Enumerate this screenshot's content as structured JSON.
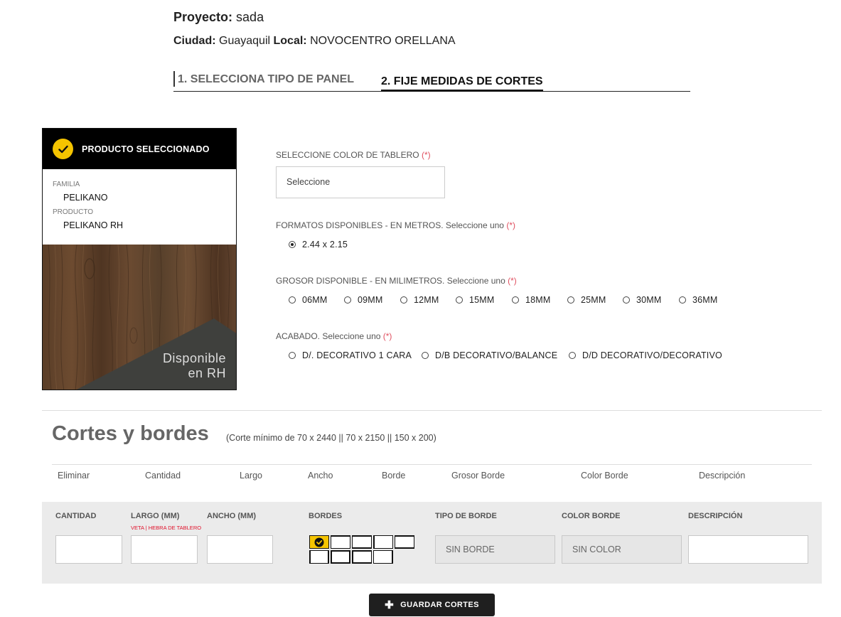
{
  "header": {
    "proyecto_label": "Proyecto:",
    "proyecto_value": "sada",
    "ciudad_label": "Ciudad:",
    "ciudad_value": "Guayaquil",
    "local_label": "Local:",
    "local_value": "NOVOCENTRO ORELLANA"
  },
  "steps": {
    "step1": "1. SELECCIONA TIPO DE PANEL",
    "step2": "2. FIJE MEDIDAS DE CORTES"
  },
  "product_card": {
    "title": "PRODUCTO SELECCIONADO",
    "familia_label": "FAMILIA",
    "familia_value": "PELIKANO",
    "producto_label": "PRODUCTO",
    "producto_value": "PELIKANO RH",
    "badge_line1": "Disponible",
    "badge_line2": "en RH",
    "accent_color": "#f5c400"
  },
  "form": {
    "color_label": "SELECCIONE COLOR DE TABLERO",
    "required_mark": "(*)",
    "color_placeholder": "Seleccione",
    "formatos_label": "FORMATOS DISPONIBLES - EN METROS. Seleccione uno",
    "formatos_options": [
      "2.44 x 2.15"
    ],
    "formatos_selected": "2.44 x 2.15",
    "grosor_label": "GROSOR DISPONIBLE - EN MILIMETROS. Seleccione uno",
    "grosor_options": [
      "06MM",
      "09MM",
      "12MM",
      "15MM",
      "18MM",
      "25MM",
      "30MM",
      "36MM"
    ],
    "acabado_label": "ACABADO. Seleccione uno",
    "acabado_options": [
      "D/. DECORATIVO 1 CARA",
      "D/B DECORATIVO/BALANCE",
      "D/D DECORATIVO/DECORATIVO"
    ]
  },
  "cortes": {
    "title": "Cortes y bordes",
    "note": "(Corte mínimo de 70 x 2440 || 70 x 2150 || 150 x 200)",
    "columns": [
      "Eliminar",
      "Cantidad",
      "Largo",
      "Ancho",
      "Borde",
      "Grosor Borde",
      "Color Borde",
      "Descripción"
    ]
  },
  "entry": {
    "cantidad_label": "CANTIDAD",
    "largo_label": "LARGO (MM)",
    "veta_note": "VETA | HEBRA DE TABLERO",
    "ancho_label": "ANCHO (MM)",
    "bordes_label": "BORDES",
    "tipo_borde_label": "TIPO DE BORDE",
    "tipo_borde_value": "SIN BORDE",
    "color_borde_label": "COLOR BORDE",
    "color_borde_value": "SIN COLOR",
    "descripcion_label": "DESCRIPCIÓN"
  },
  "actions": {
    "save_label": "GUARDAR CORTES"
  }
}
